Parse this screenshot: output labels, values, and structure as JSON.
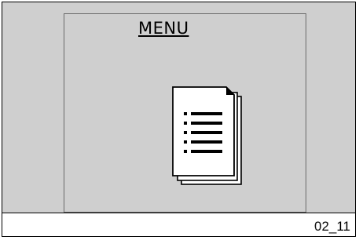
{
  "display": {
    "menu_label": "MENU",
    "icon": "document-list-icon"
  },
  "figure_code": "02_11"
}
